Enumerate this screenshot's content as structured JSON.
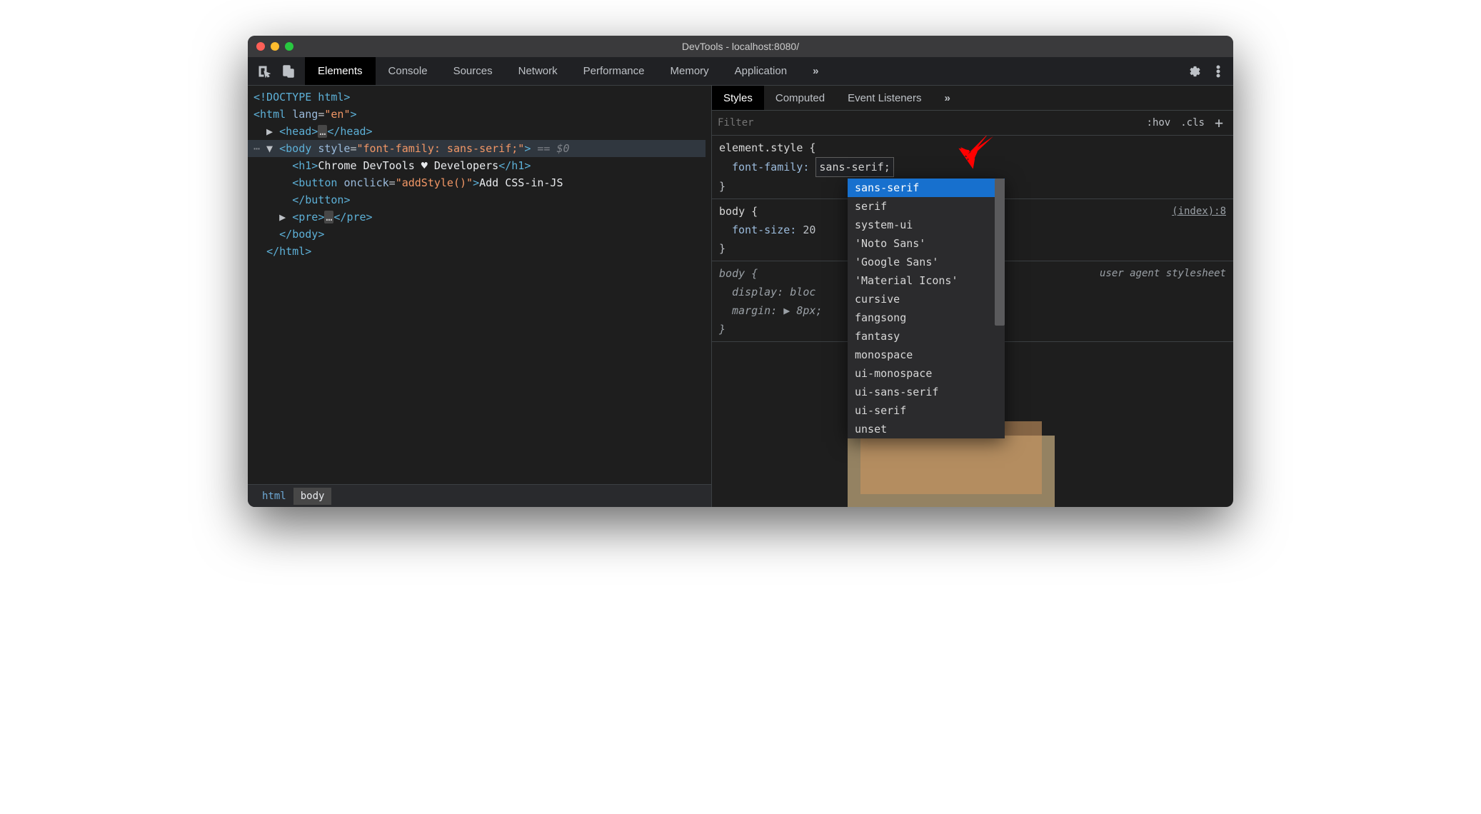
{
  "window": {
    "title": "DevTools - localhost:8080/"
  },
  "tabs": {
    "items": [
      "Elements",
      "Console",
      "Sources",
      "Network",
      "Performance",
      "Memory",
      "Application"
    ],
    "active": "Elements",
    "overflow": "»"
  },
  "dom": {
    "doctype": "<!DOCTYPE html>",
    "html_open": {
      "tag": "html",
      "attr": "lang",
      "val": "en"
    },
    "head": {
      "open": "head",
      "dots": "…",
      "close": "head"
    },
    "body_open": {
      "tag": "body",
      "attr": "style",
      "val": "font-family: sans-serif;",
      "suffix": "== $0"
    },
    "h1": {
      "tag": "h1",
      "text": "Chrome DevTools ♥ Developers"
    },
    "button": {
      "tag": "button",
      "attr": "onclick",
      "val": "addStyle()",
      "text": "Add CSS-in-JS"
    },
    "pre": {
      "tag": "pre",
      "dots": "…"
    },
    "body_close": "body",
    "html_close": "html"
  },
  "breadcrumb": [
    "html",
    "body"
  ],
  "styles": {
    "tabs": [
      "Styles",
      "Computed",
      "Event Listeners"
    ],
    "tabs_active": "Styles",
    "tabs_overflow": "»",
    "filter": {
      "placeholder": "Filter",
      "hov": ":hov",
      "cls": ".cls"
    },
    "rules": {
      "element_style": {
        "selector": "element.style {",
        "prop": "font-family",
        "val": "sans-serif;",
        "close": "}"
      },
      "body1": {
        "selector": "body {",
        "link": "(index):8",
        "prop": "font-size",
        "val": "20",
        "close": "}"
      },
      "body_ua": {
        "selector": "body {",
        "link": "user agent stylesheet",
        "prop1": "display",
        "val1": "bloc",
        "prop2": "margin",
        "val2": "8px;",
        "close": "}"
      }
    },
    "autocomplete": [
      "sans-serif",
      "serif",
      "system-ui",
      "'Noto Sans'",
      "'Google Sans'",
      "'Material Icons'",
      "cursive",
      "fangsong",
      "fantasy",
      "monospace",
      "ui-monospace",
      "ui-sans-serif",
      "ui-serif",
      "unset"
    ],
    "autocomplete_selected": "sans-serif"
  }
}
